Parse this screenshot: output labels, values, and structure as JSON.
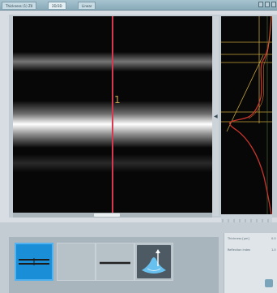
{
  "titlebar": {
    "tabs": [
      {
        "label": "Thickness (1) Z0",
        "active": false
      },
      {
        "label": "2D/3D",
        "active": true
      },
      {
        "label": "Linear",
        "active": false
      }
    ]
  },
  "image_view": {
    "cursor_label": "1"
  },
  "info_panel": {
    "rows": [
      {
        "label": "Thickness [µm]",
        "value": "0.0"
      },
      {
        "label": "Reflection index",
        "value": "1.0"
      }
    ]
  },
  "colors": {
    "cursor": "#d43b4f",
    "cursor_label": "#c6a255",
    "active_tool": "#1b8ed8",
    "profile_curve_red": "#c8352c",
    "profile_curve_orange": "#ca7a2e"
  },
  "toolbar": {
    "tools": [
      {
        "icon": "line-profile-icon",
        "active": true
      },
      {
        "icon": "blank-tool",
        "active": false
      },
      {
        "icon": "single-line-icon",
        "active": false
      },
      {
        "icon": "3d-surface-icon",
        "active": false
      }
    ]
  }
}
